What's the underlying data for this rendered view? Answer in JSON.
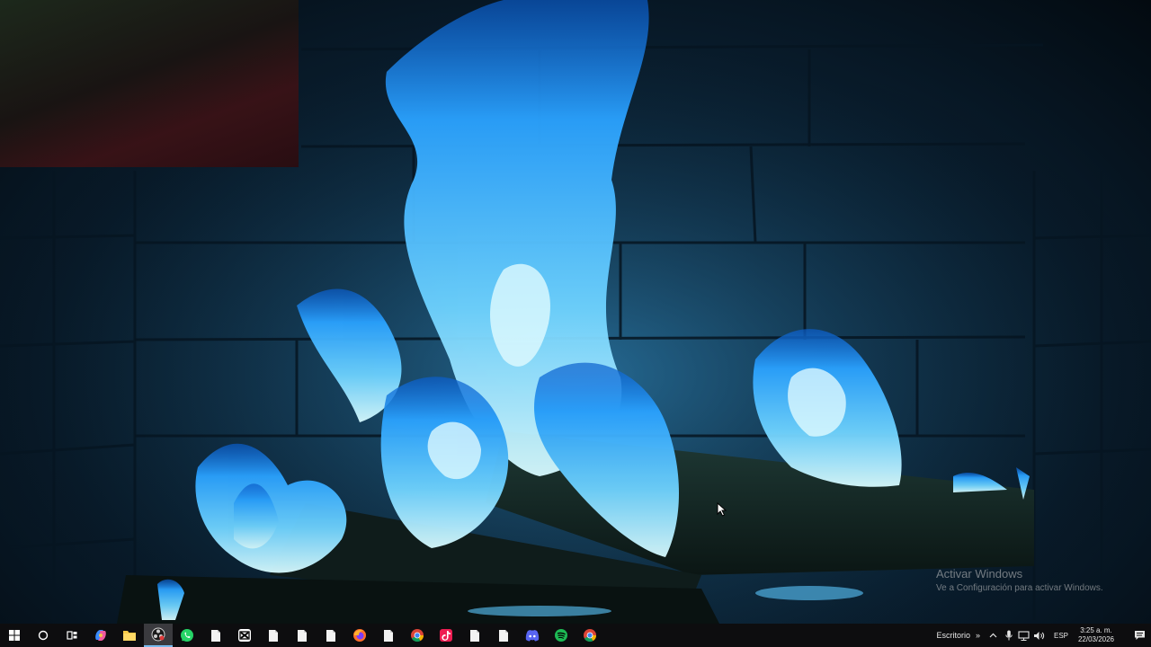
{
  "wallpaper": {
    "description_icon": "blue-fireplace-wallpaper"
  },
  "activation": {
    "title": "Activar Windows",
    "subtitle": "Ve a Configuración para activar Windows."
  },
  "taskbar": {
    "items": [
      {
        "name": "start-button",
        "icon": "windows-logo-icon"
      },
      {
        "name": "search-button",
        "icon": "search-circle-icon"
      },
      {
        "name": "task-view-button",
        "icon": "task-view-icon"
      },
      {
        "name": "app-copilot",
        "icon": "copilot-icon"
      },
      {
        "name": "app-file-explorer",
        "icon": "folder-icon"
      },
      {
        "name": "app-obs",
        "icon": "obs-icon",
        "active": true
      },
      {
        "name": "app-whatsapp",
        "icon": "whatsapp-icon"
      },
      {
        "name": "app-file-1",
        "icon": "file-icon"
      },
      {
        "name": "app-capcut",
        "icon": "capcut-icon"
      },
      {
        "name": "app-file-2",
        "icon": "file-icon"
      },
      {
        "name": "app-file-3",
        "icon": "file-icon"
      },
      {
        "name": "app-file-4",
        "icon": "file-icon"
      },
      {
        "name": "app-firefox",
        "icon": "firefox-icon"
      },
      {
        "name": "app-file-5",
        "icon": "file-icon"
      },
      {
        "name": "app-chrome-1",
        "icon": "chrome-icon"
      },
      {
        "name": "app-tiktok",
        "icon": "tiktok-icon"
      },
      {
        "name": "app-file-6",
        "icon": "file-icon"
      },
      {
        "name": "app-file-7",
        "icon": "file-icon"
      },
      {
        "name": "app-discord",
        "icon": "discord-icon"
      },
      {
        "name": "app-spotify",
        "icon": "spotify-icon"
      },
      {
        "name": "app-chrome-2",
        "icon": "chrome-icon"
      }
    ],
    "toolbar_label": "Escritorio",
    "toolbar_chevron": "»",
    "language": "ESP",
    "time": "3:25 a. m.",
    "date": "22/03/2026"
  },
  "colors": {
    "taskbar_bg": "#0d0d0f",
    "active_accent": "#76b9ed",
    "flame_light": "#bff4ff",
    "flame_mid": "#39b6ff",
    "flame_dark": "#0a6ed8"
  }
}
